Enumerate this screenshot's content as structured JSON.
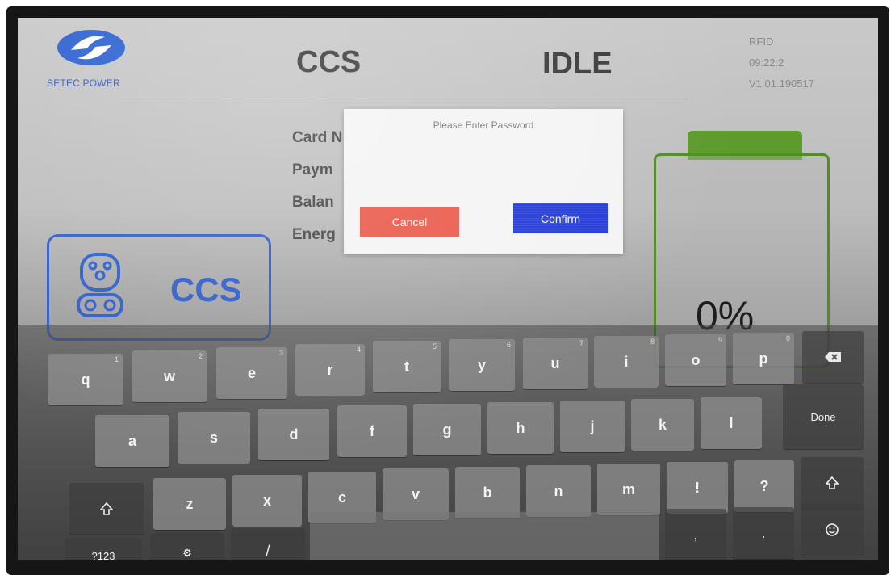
{
  "header": {
    "brand": "SETEC POWER",
    "connector": "CCS",
    "status": "IDLE",
    "auth_mode": "RFID",
    "time": "09:22:2",
    "version": "V1.01.190517"
  },
  "info_lines": [
    "Card N",
    "Paym",
    "Balan",
    "Energ"
  ],
  "connector_card": {
    "label": "CCS"
  },
  "battery": {
    "percent": "0%",
    "color": "#4e8f22"
  },
  "dialog": {
    "title": "Please Enter Password",
    "cancel_label": "Cancel",
    "confirm_label": "Confirm",
    "cancel_color": "#ea5a4b",
    "confirm_color": "#2138d6"
  },
  "keyboard": {
    "row1": [
      {
        "label": "q",
        "hint": "1"
      },
      {
        "label": "w",
        "hint": "2"
      },
      {
        "label": "e",
        "hint": "3"
      },
      {
        "label": "r",
        "hint": "4"
      },
      {
        "label": "t",
        "hint": "5"
      },
      {
        "label": "y",
        "hint": "6"
      },
      {
        "label": "u",
        "hint": "7"
      },
      {
        "label": "i",
        "hint": "8"
      },
      {
        "label": "o",
        "hint": "9"
      },
      {
        "label": "p",
        "hint": "0"
      }
    ],
    "row2": [
      {
        "label": "a"
      },
      {
        "label": "s"
      },
      {
        "label": "d"
      },
      {
        "label": "f"
      },
      {
        "label": "g"
      },
      {
        "label": "h"
      },
      {
        "label": "j"
      },
      {
        "label": "k"
      },
      {
        "label": "l"
      }
    ],
    "row3": [
      {
        "label": "z"
      },
      {
        "label": "x"
      },
      {
        "label": "c"
      },
      {
        "label": "v"
      },
      {
        "label": "b"
      },
      {
        "label": "n"
      },
      {
        "label": "m"
      },
      {
        "label": "!"
      },
      {
        "label": "?"
      }
    ],
    "done_label": "Done",
    "symbols_label": "?123",
    "settings_label": "⚙",
    "slash_label": "/",
    "comma_label": ",",
    "period_label": ".",
    "backspace_icon": "backspace-icon",
    "shift_icon": "shift-icon",
    "emoji_icon": "emoji-icon"
  }
}
